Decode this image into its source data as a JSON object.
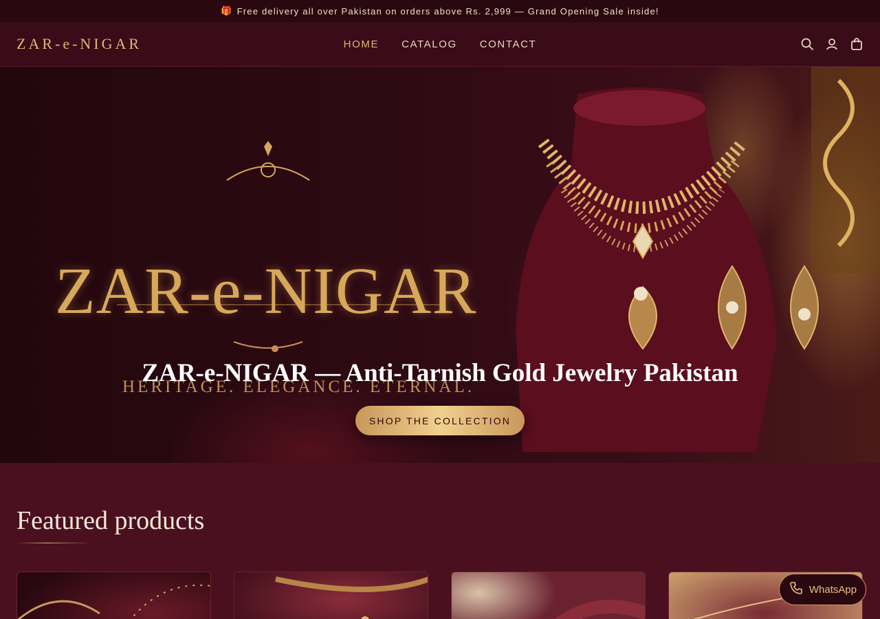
{
  "announcement": {
    "icon": "gift-icon",
    "text": "Free delivery all over Pakistan on orders above Rs. 2,999 — Grand Opening Sale inside!"
  },
  "header": {
    "logo": "ZAR-e-NIGAR",
    "nav": [
      {
        "label": "HOME",
        "active": true
      },
      {
        "label": "CATALOG",
        "active": false
      },
      {
        "label": "CONTACT",
        "active": false
      }
    ],
    "icons": [
      "search-icon",
      "account-icon",
      "cart-icon"
    ]
  },
  "hero": {
    "image_brand": "ZAR-e-NIGAR",
    "image_tagline": "HERITAGE. ELEGANCE. ETERNAL.",
    "title": "ZAR-e-NIGAR — Anti-Tarnish Gold Jewelry Pakistan",
    "cta": "SHOP THE COLLECTION"
  },
  "featured": {
    "heading": "Featured products"
  },
  "whatsapp": {
    "label": "WhatsApp",
    "icon": "phone-icon"
  },
  "colors": {
    "accent_gold": "#e3b871",
    "background": "#4a1020",
    "header": "#3a0b18",
    "announcement": "#2a0810"
  }
}
